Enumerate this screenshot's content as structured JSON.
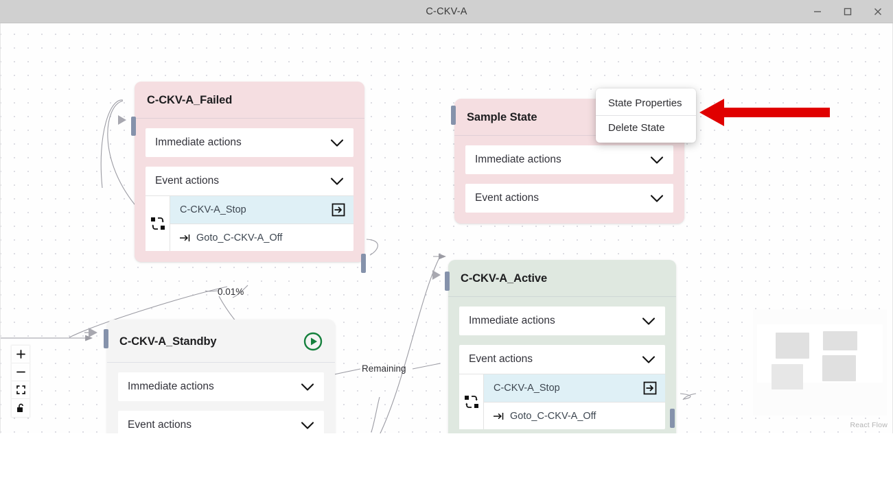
{
  "window": {
    "title": "C-CKV-A",
    "minimize_label": "Minimize",
    "maximize_label": "Maximize",
    "close_label": "Close"
  },
  "canvas": {
    "attribution": "React Flow"
  },
  "nodes": [
    {
      "id": "failed",
      "title": "C-CKV-A_Failed",
      "color": "pink",
      "is_start": false,
      "sections": [
        {
          "label": "Immediate actions",
          "expanded": false,
          "rows": []
        },
        {
          "label": "Event actions",
          "expanded": true,
          "rows": [
            {
              "label": "C-CKV-A_Stop",
              "selected": true,
              "icon": "login-arrow-icon"
            },
            {
              "label": "Goto_C-CKV-A_Off",
              "selected": false,
              "icon": "goto-arrow-icon"
            }
          ]
        }
      ]
    },
    {
      "id": "sample",
      "title": "Sample State",
      "color": "pink",
      "is_start": false,
      "sections": [
        {
          "label": "Immediate actions",
          "expanded": false,
          "rows": []
        },
        {
          "label": "Event actions",
          "expanded": false,
          "rows": []
        }
      ]
    },
    {
      "id": "active",
      "title": "C-CKV-A_Active",
      "color": "green",
      "is_start": false,
      "sections": [
        {
          "label": "Immediate actions",
          "expanded": false,
          "rows": []
        },
        {
          "label": "Event actions",
          "expanded": true,
          "rows": [
            {
              "label": "C-CKV-A_Stop",
              "selected": true,
              "icon": "login-arrow-icon"
            },
            {
              "label": "Goto_C-CKV-A_Off",
              "selected": false,
              "icon": "goto-arrow-icon"
            }
          ]
        }
      ]
    },
    {
      "id": "standby",
      "title": "C-CKV-A_Standby",
      "color": "gray",
      "is_start": true,
      "sections": [
        {
          "label": "Immediate actions",
          "expanded": false,
          "rows": []
        },
        {
          "label": "Event actions",
          "expanded": false,
          "rows": []
        }
      ]
    }
  ],
  "edge_labels": [
    {
      "text": "0.01%"
    },
    {
      "text": "Remaining"
    }
  ],
  "context_menu": {
    "items": [
      {
        "label": "State Properties"
      },
      {
        "label": "Delete State"
      }
    ]
  },
  "controls": {
    "zoom_in": "zoom-in",
    "zoom_out": "zoom-out",
    "fit_view": "fit-view",
    "lock": "interactivity-lock"
  },
  "colors": {
    "node_pink": "#f5dee1",
    "node_green": "#dfe8e0",
    "node_gray": "#f4f4f4",
    "row_selected": "#dff0f6",
    "handle": "#8592ab",
    "start_badge": "#15803d",
    "annotation_arrow": "#e00000",
    "edge_stroke": "#9b9ba3",
    "titlebar": "#d0d0d0"
  }
}
